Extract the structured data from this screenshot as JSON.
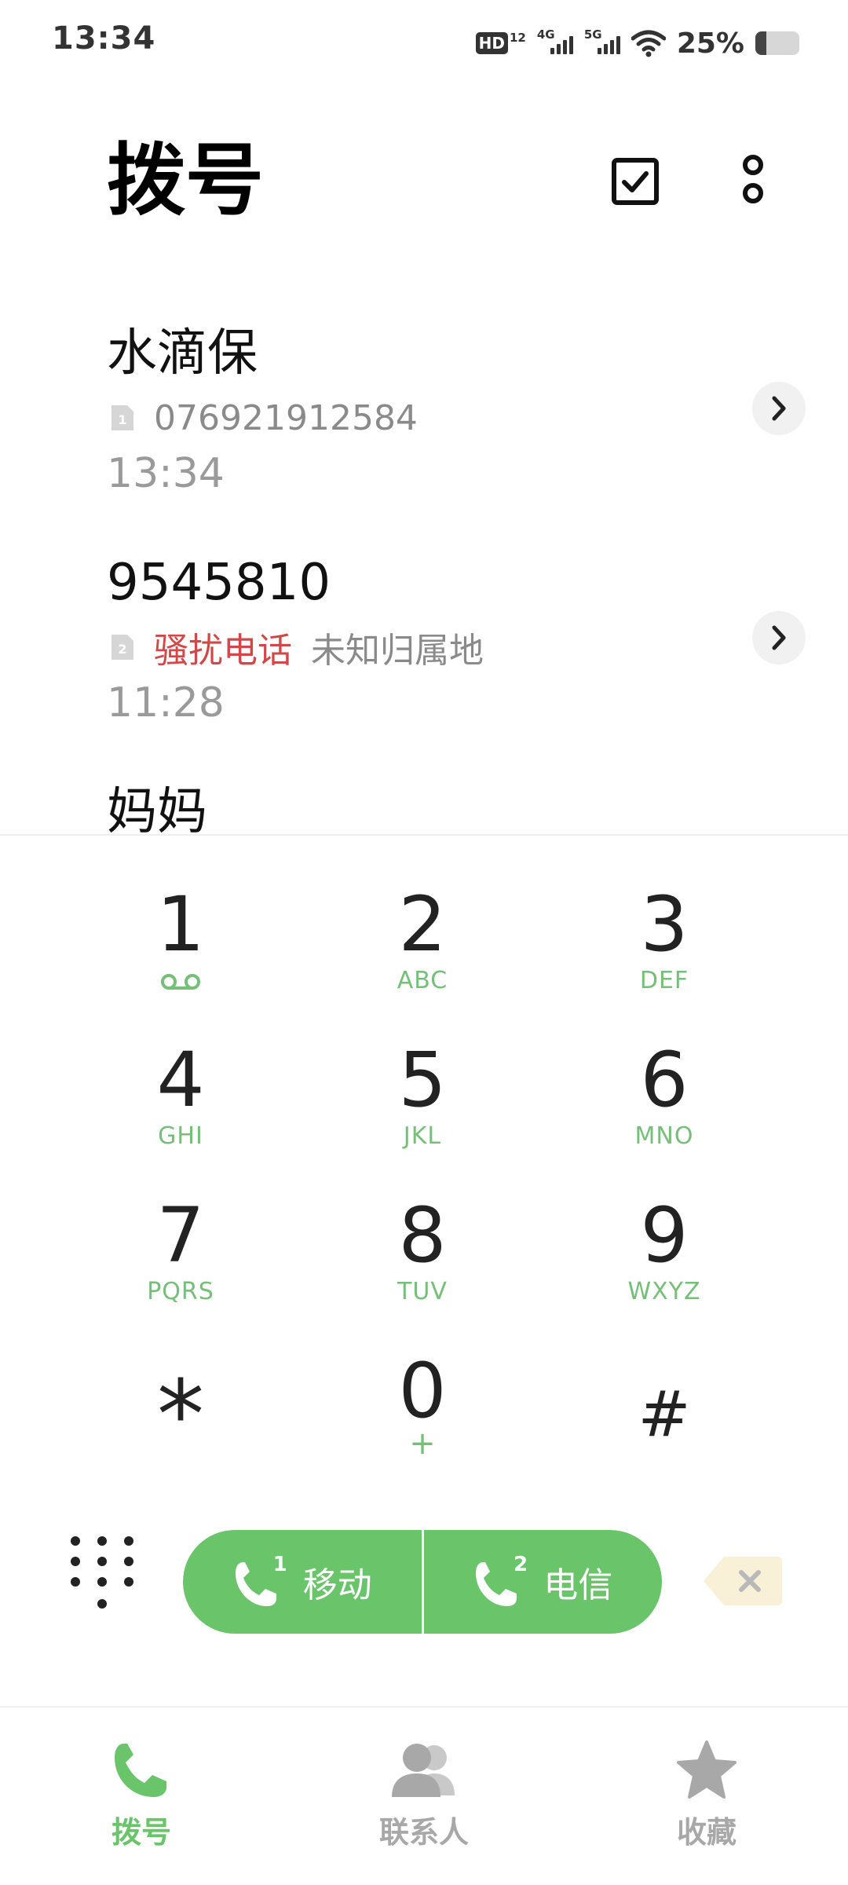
{
  "status_bar": {
    "time": "13:34",
    "hd_label": "HD",
    "hd_sub": "12",
    "sim1_network": "4G",
    "sim2_network": "5G",
    "battery_percent": "25%",
    "battery_level": 0.25
  },
  "header": {
    "title": "拨号",
    "select_icon": "checkbox-icon",
    "more_icon": "more-vertical-icon"
  },
  "call_log": [
    {
      "name": "水滴保",
      "sim": "1",
      "detail": "076921912584",
      "tag": "",
      "time": "13:34"
    },
    {
      "name": "9545810",
      "sim": "2",
      "detail": "未知归属地",
      "tag": "骚扰电话",
      "time": "11:28"
    },
    {
      "name": "妈妈",
      "sim": "",
      "detail": "",
      "tag": "",
      "time": ""
    }
  ],
  "dialpad": {
    "keys": [
      {
        "digit": "1",
        "letters": ""
      },
      {
        "digit": "2",
        "letters": "ABC"
      },
      {
        "digit": "3",
        "letters": "DEF"
      },
      {
        "digit": "4",
        "letters": "GHI"
      },
      {
        "digit": "5",
        "letters": "JKL"
      },
      {
        "digit": "6",
        "letters": "MNO"
      },
      {
        "digit": "7",
        "letters": "PQRS"
      },
      {
        "digit": "8",
        "letters": "TUV"
      },
      {
        "digit": "9",
        "letters": "WXYZ"
      },
      {
        "digit": "*",
        "letters": ""
      },
      {
        "digit": "0",
        "letters": "+"
      },
      {
        "digit": "#",
        "letters": ""
      }
    ]
  },
  "actions": {
    "sim1_number": "1",
    "sim1_label": "移动",
    "sim2_number": "2",
    "sim2_label": "电信"
  },
  "bottom_nav": [
    {
      "label": "拨号",
      "icon": "phone-icon",
      "active": true
    },
    {
      "label": "联系人",
      "icon": "contacts-icon",
      "active": false
    },
    {
      "label": "收藏",
      "icon": "star-icon",
      "active": false
    }
  ],
  "colors": {
    "accent_green": "#6ac46a",
    "letters_green": "#76bf78",
    "spam_red": "#d24848",
    "inactive_gray": "#a8a8a8"
  }
}
